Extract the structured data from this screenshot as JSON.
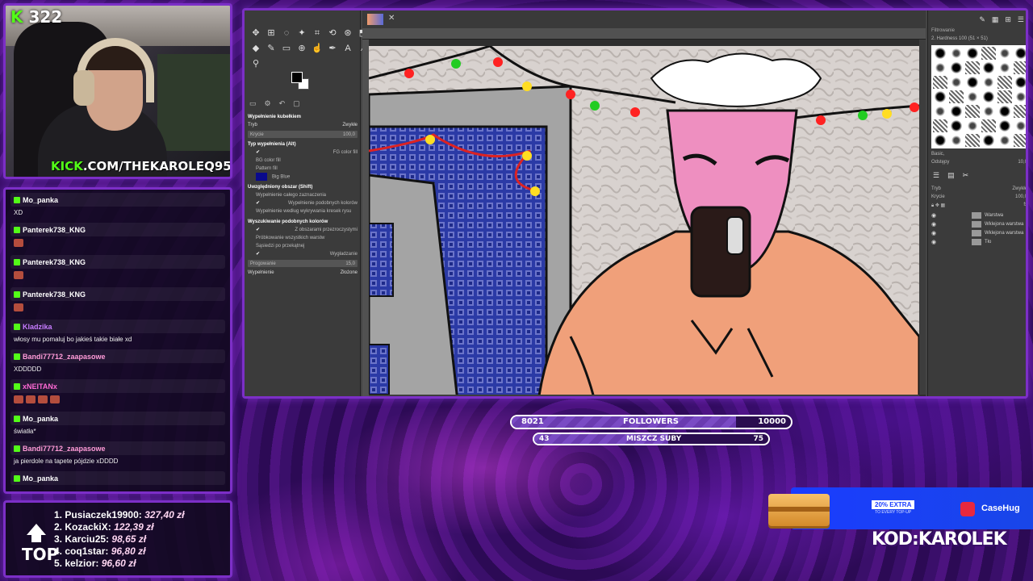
{
  "webcam": {
    "viewer_count": "322",
    "kick_prefix": "KICK",
    "channel_suffix": ".COM/THEKAROLEQ95"
  },
  "chat": {
    "messages": [
      {
        "user": "Mo_panka",
        "text": "XD",
        "color": "#ffffff",
        "emotes": 0
      },
      {
        "user": "Panterek738_KNG",
        "text": "",
        "color": "#ffffff",
        "emotes": 1
      },
      {
        "user": "Panterek738_KNG",
        "text": "",
        "color": "#ffffff",
        "emotes": 1
      },
      {
        "user": "Panterek738_KNG",
        "text": "",
        "color": "#ffffff",
        "emotes": 1
      },
      {
        "user": "Kladzika",
        "text": "włosy mu pomaluj bo jakieś takie białe xd",
        "color": "#c77dff",
        "emotes": 0
      },
      {
        "user": "Bandi77712_zaapasowe",
        "text": "XDDDDD",
        "color": "#ff9bd8",
        "emotes": 0
      },
      {
        "user": "xNEITANx",
        "text": "",
        "color": "#ff6ad5",
        "emotes": 4
      },
      {
        "user": "Mo_panka",
        "text": "światła*",
        "color": "#ffffff",
        "emotes": 0
      },
      {
        "user": "Bandi77712_zaapasowe",
        "text": "ja pierdole na tapete pójdzie xDDDD",
        "color": "#ff9bd8",
        "emotes": 0
      },
      {
        "user": "Mo_panka",
        "text": "",
        "color": "#ffffff",
        "emotes": 0
      }
    ]
  },
  "donors": {
    "label": "TOP",
    "list": [
      {
        "rank": "1.",
        "name": "Pusiaczek19900:",
        "amount": "327,40 zł"
      },
      {
        "rank": "2.",
        "name": "KozackiX:",
        "amount": "122,39 zł"
      },
      {
        "rank": "3.",
        "name": "Karciu25:",
        "amount": "98,65 zł"
      },
      {
        "rank": "4.",
        "name": "coq1star:",
        "amount": "96,80 zł"
      },
      {
        "rank": "5.",
        "name": "kelzior:",
        "amount": "96,60 zł"
      }
    ]
  },
  "gimp": {
    "tool_options_tabs": [
      "▭",
      "⚙",
      "↶",
      "▢"
    ],
    "options": {
      "title": "Wypełnienie kubełkiem",
      "mode_label": "Tryb",
      "mode_value": "Zwykłe",
      "opacity_label": "Krycie",
      "opacity_value": "100,0",
      "fill_type_label": "Typ wypełnienia (Alt)",
      "fill_fg": "FG color fill",
      "fill_bg": "BG color fill",
      "fill_pattern": "Pattern fill",
      "pattern_name": "Big Blue",
      "area_label": "Uwzględniony obszar (Shift)",
      "area_selection": "Wypełnienie całego zaznaczenia",
      "area_similar": "Wypełnienie podobnych kolorów",
      "area_lineart": "Wypełnienie według wykrywania kresek rysu",
      "similar_label": "Wyszukiwanie podobnych kolorów",
      "transparent": "Z obszarami przezroczystymi",
      "sample_merged": "Próbkowanie wszystkich warstw",
      "diagonal": "Sąsiedzi po przekątnej",
      "antialias": "Wygładzanie",
      "threshold_label": "Progowanie",
      "threshold_value": "15,0",
      "fill_by_label": "Wypełnienie",
      "fill_by_value": "Złożone"
    },
    "dock": {
      "filter": "Filtrowanie",
      "brush_name": "2. Hardness 100 (51 × 51)",
      "preset": "Basic,",
      "spacing_label": "Odstępy",
      "spacing_value": "10,0",
      "mode_label": "Tryb",
      "mode_value": "Zwykłe",
      "opacity_label": "Krycie",
      "opacity_value": "100,0",
      "layers": [
        "Warstwa",
        "Wklejona warstwa",
        "Wklejona warstwa",
        "Tło"
      ]
    }
  },
  "goals": {
    "followers": {
      "current": "8021",
      "label": "FOLLOWERS",
      "target": "10000",
      "progress": 0.8021
    },
    "subs": {
      "current": "43",
      "label": "MISZCZ SUBY",
      "target": "75",
      "progress": 0.573
    }
  },
  "sponsor": {
    "extra": "20% EXTRA",
    "extra_sub": "TO EVERY TOP-UP",
    "brand": "CaseHug",
    "code": "KOD:KAROLEK"
  }
}
